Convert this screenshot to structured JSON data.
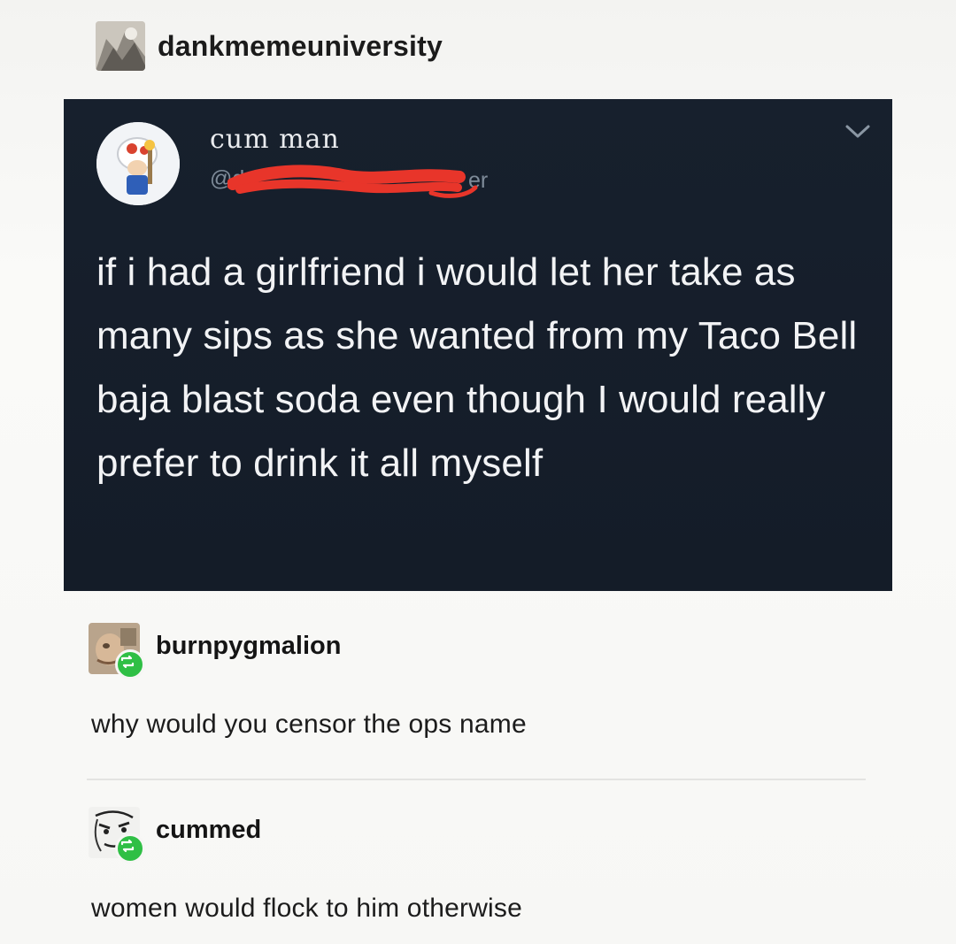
{
  "header": {
    "username": "dankmemeuniversity",
    "avatar_icon": "photo-avatar"
  },
  "tweet": {
    "display_name": "cum man",
    "handle": "@d",
    "handle_tail": "er",
    "body": "if i had a girlfriend i would let her take as many sips as she wanted from my Taco Bell baja blast soda even though I would really prefer to drink it all myself",
    "colors": {
      "card_bg": "#15202e",
      "text": "#f2f3f5",
      "handle": "#7e8b99",
      "redaction": "#e8352a"
    }
  },
  "reblogs": [
    {
      "username": "burnpygmalion",
      "text": "why would you censor the ops name",
      "badge_icon": "reblog-icon"
    },
    {
      "username": "cummed",
      "text": "women would flock to him otherwise",
      "badge_icon": "reblog-icon"
    }
  ],
  "colors": {
    "reblog_badge": "#2fbf45"
  }
}
